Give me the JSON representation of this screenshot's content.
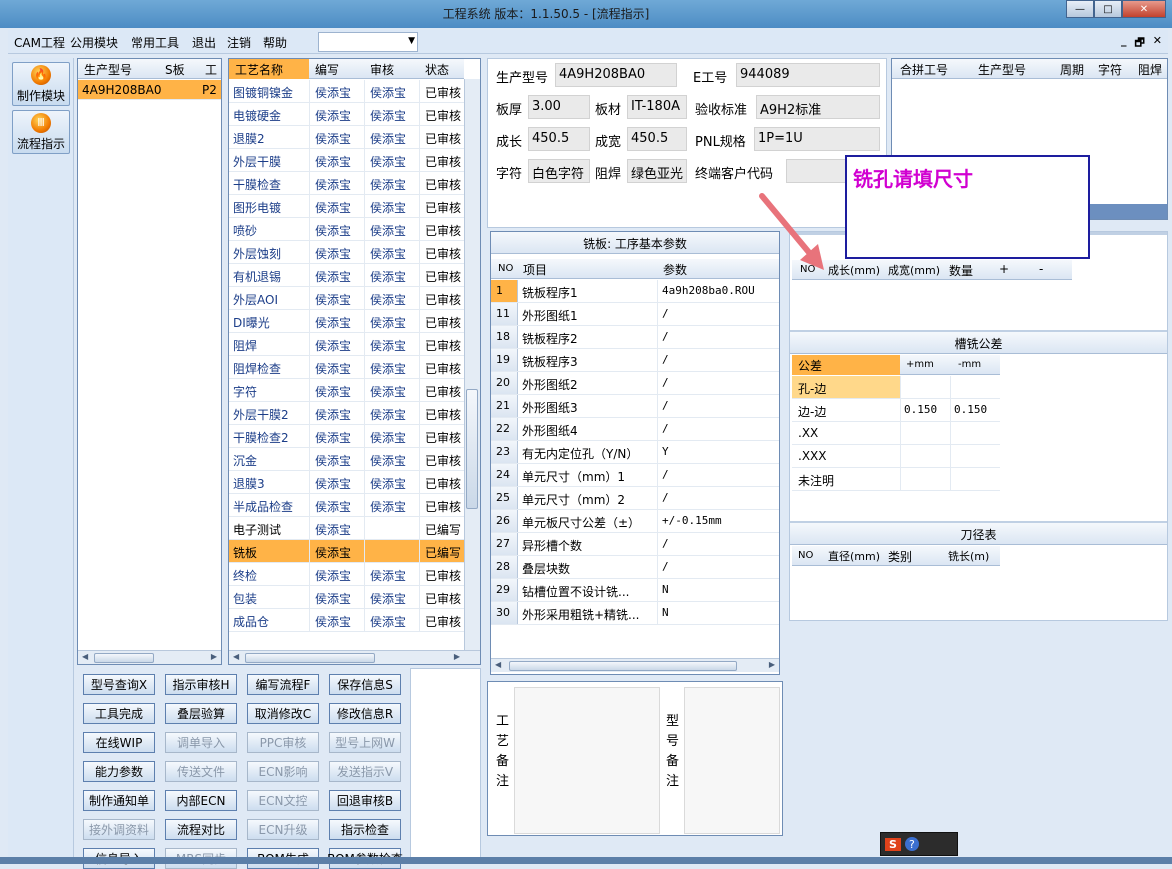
{
  "window": {
    "title": "工程系统   版本：1.1.50.5 - [流程指示]",
    "min": "—",
    "max": "□",
    "close": "✕"
  },
  "menu": {
    "items": [
      "CAM工程",
      "公用模块",
      "常用工具",
      "退出",
      "注销",
      "帮助"
    ],
    "mdi": [
      "_",
      "🗗",
      "✕"
    ]
  },
  "nav": {
    "buttons": [
      "制作模块",
      "流程指示"
    ],
    "icons": [
      "🔥",
      "Ⅲ"
    ]
  },
  "model_grid": {
    "headers": [
      "生产型号",
      "S板",
      "工"
    ],
    "rows": [
      {
        "model": "4A9H208BA0",
        "s": "P2"
      }
    ]
  },
  "process_grid": {
    "headers": [
      "工艺名称",
      "编写",
      "审核",
      "状态"
    ],
    "rows": [
      {
        "name": "图镀铜镍金",
        "writer": "侯添宝",
        "reviewer": "侯添宝",
        "status": "已审核"
      },
      {
        "name": "电镀硬金",
        "writer": "侯添宝",
        "reviewer": "侯添宝",
        "status": "已审核"
      },
      {
        "name": "退膜2",
        "writer": "侯添宝",
        "reviewer": "侯添宝",
        "status": "已审核"
      },
      {
        "name": "外层干膜",
        "writer": "侯添宝",
        "reviewer": "侯添宝",
        "status": "已审核"
      },
      {
        "name": "干膜检查",
        "writer": "侯添宝",
        "reviewer": "侯添宝",
        "status": "已审核"
      },
      {
        "name": "图形电镀",
        "writer": "侯添宝",
        "reviewer": "侯添宝",
        "status": "已审核"
      },
      {
        "name": "喷砂",
        "writer": "侯添宝",
        "reviewer": "侯添宝",
        "status": "已审核"
      },
      {
        "name": "外层蚀刻",
        "writer": "侯添宝",
        "reviewer": "侯添宝",
        "status": "已审核"
      },
      {
        "name": "有机退锡",
        "writer": "侯添宝",
        "reviewer": "侯添宝",
        "status": "已审核"
      },
      {
        "name": "外层AOI",
        "writer": "侯添宝",
        "reviewer": "侯添宝",
        "status": "已审核"
      },
      {
        "name": "DI曝光",
        "writer": "侯添宝",
        "reviewer": "侯添宝",
        "status": "已审核"
      },
      {
        "name": "阻焊",
        "writer": "侯添宝",
        "reviewer": "侯添宝",
        "status": "已审核"
      },
      {
        "name": "阻焊检查",
        "writer": "侯添宝",
        "reviewer": "侯添宝",
        "status": "已审核"
      },
      {
        "name": "字符",
        "writer": "侯添宝",
        "reviewer": "侯添宝",
        "status": "已审核"
      },
      {
        "name": "外层干膜2",
        "writer": "侯添宝",
        "reviewer": "侯添宝",
        "status": "已审核"
      },
      {
        "name": "干膜检查2",
        "writer": "侯添宝",
        "reviewer": "侯添宝",
        "status": "已审核"
      },
      {
        "name": "沉金",
        "writer": "侯添宝",
        "reviewer": "侯添宝",
        "status": "已审核"
      },
      {
        "name": "退膜3",
        "writer": "侯添宝",
        "reviewer": "侯添宝",
        "status": "已审核"
      },
      {
        "name": "半成品检查",
        "writer": "侯添宝",
        "reviewer": "侯添宝",
        "status": "已审核"
      },
      {
        "name": "电子测试",
        "writer": "侯添宝",
        "reviewer": "",
        "status": "已编写"
      },
      {
        "name": "铣板",
        "writer": "侯添宝",
        "reviewer": "",
        "status": "已编写"
      },
      {
        "name": "终检",
        "writer": "侯添宝",
        "reviewer": "侯添宝",
        "status": "已审核"
      },
      {
        "name": "包装",
        "writer": "侯添宝",
        "reviewer": "侯添宝",
        "status": "已审核"
      },
      {
        "name": "成品仓",
        "writer": "侯添宝",
        "reviewer": "侯添宝",
        "status": "已审核"
      }
    ]
  },
  "buttons": [
    [
      "型号查询X",
      "指示审核H",
      "编写流程F",
      "保存信息S"
    ],
    [
      "工具完成",
      "叠层验算",
      "取消修改C",
      "修改信息R"
    ],
    [
      "在线WIP",
      "调单导入",
      "PPC审核",
      "型号上网W"
    ],
    [
      "能力参数",
      "传送文件",
      "ECN影响",
      "发送指示V"
    ],
    [
      "制作通知单",
      "内部ECN",
      "ECN文控",
      "回退审核B"
    ],
    [
      "接外调资料",
      "流程对比",
      "ECN升级",
      "指示检查"
    ],
    [
      "信息导入",
      "MRS同步",
      "BOM生成",
      "BOM参数检查"
    ]
  ],
  "disabled_buttons": [
    "调单导入",
    "PPC审核",
    "型号上网W",
    "传送文件",
    "ECN影响",
    "发送指示V",
    "ECN文控",
    "接外调资料",
    "ECN升级",
    "MRS同步"
  ],
  "info": {
    "model_label": "生产型号",
    "model": "4A9H208BA0",
    "e_label": "E工号",
    "e": "944089",
    "thick_label": "板厚",
    "thick": "3.00",
    "mat_label": "板材",
    "mat": "IT-180A",
    "std_label": "验收标准",
    "std": "A9H2标准",
    "len_label": "成长",
    "len": "450.5",
    "wid_label": "成宽",
    "wid": "450.5",
    "pnl_label": "PNL规格",
    "pnl": "1P=1U",
    "char_label": "字符",
    "char": "白色字符",
    "mask_label": "阻焊",
    "mask": "绿色亚光",
    "cust_label": "终端客户代码",
    "cust": ""
  },
  "panel_grid": {
    "headers": [
      "合拼工号",
      "生产型号",
      "周期",
      "字符",
      "阻焊"
    ]
  },
  "mill_params": {
    "title": "铣板: 工序基本参数",
    "headers": [
      "NO",
      "项目",
      "参数"
    ],
    "rows": [
      {
        "no": "1",
        "item": "铣板程序1",
        "value": "4a9h208ba0.ROU"
      },
      {
        "no": "11",
        "item": "外形图纸1",
        "value": "/"
      },
      {
        "no": "18",
        "item": "铣板程序2",
        "value": "/"
      },
      {
        "no": "19",
        "item": "铣板程序3",
        "value": "/"
      },
      {
        "no": "20",
        "item": "外形图纸2",
        "value": "/"
      },
      {
        "no": "21",
        "item": "外形图纸3",
        "value": "/"
      },
      {
        "no": "22",
        "item": "外形图纸4",
        "value": "/"
      },
      {
        "no": "23",
        "item": "有无内定位孔（Y/N）",
        "value": "Y"
      },
      {
        "no": "24",
        "item": "单元尺寸（mm）1",
        "value": "/"
      },
      {
        "no": "25",
        "item": "单元尺寸（mm）2",
        "value": "/"
      },
      {
        "no": "26",
        "item": "单元板尺寸公差（±）",
        "value": "+/-0.15mm"
      },
      {
        "no": "27",
        "item": "异形槽个数",
        "value": "/"
      },
      {
        "no": "28",
        "item": "叠层块数",
        "value": "/"
      },
      {
        "no": "29",
        "item": "钻槽位置不设计铣...",
        "value": "N"
      },
      {
        "no": "30",
        "item": "外形采用粗铣+精铣...",
        "value": "N"
      }
    ]
  },
  "size_grid": {
    "headers": [
      "NO",
      "成长(mm)",
      "成宽(mm)",
      "数量",
      "+",
      "-"
    ]
  },
  "tolerance": {
    "title": "槽铣公差",
    "headers": [
      "公差",
      "+mm",
      "-mm"
    ],
    "rows": [
      {
        "name": "孔-边",
        "plus": "",
        "minus": ""
      },
      {
        "name": "边-边",
        "plus": "0.150",
        "minus": "0.150"
      },
      {
        "name": ".XX",
        "plus": "",
        "minus": ""
      },
      {
        "name": ".XXX",
        "plus": "",
        "minus": ""
      },
      {
        "name": "未注明",
        "plus": "",
        "minus": ""
      }
    ]
  },
  "tool_table": {
    "title": "刀径表",
    "headers": [
      "NO",
      "直径(mm)",
      "类别",
      "铣长(m)"
    ]
  },
  "remarks": {
    "process": "工艺备注",
    "model": "型号备注"
  },
  "tip": {
    "text": "铣孔请填尺寸"
  },
  "tray": {
    "items": [
      "S",
      "?"
    ]
  },
  "colors": {
    "accent": "#ffb347",
    "tip_border": "#1d1d9e",
    "tip_text": "#d100d1",
    "arrow": "#e8737b"
  }
}
